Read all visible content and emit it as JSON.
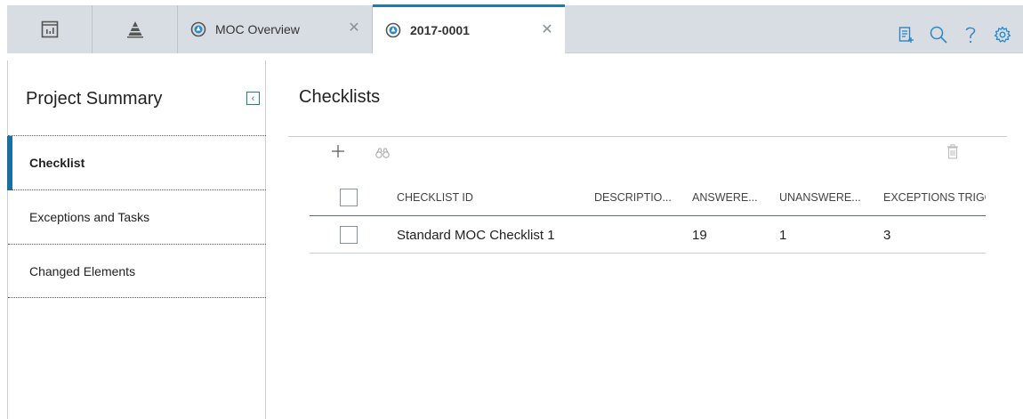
{
  "colors": {
    "accent": "#1b7bb0",
    "link": "#2a7dc4",
    "tab_bg": "#d7dde3"
  },
  "tabs": {
    "icon_tabs": [
      "dashboard-icon",
      "pyramid-icon"
    ],
    "items": [
      {
        "label": "MOC Overview",
        "icon": "moc-cycle-icon",
        "active": false
      },
      {
        "label": "2017-0001",
        "icon": "moc-cycle-icon",
        "active": true
      }
    ]
  },
  "toolbar_icons": [
    "clipboard-add-icon",
    "search-icon",
    "help-icon",
    "settings-icon"
  ],
  "sidebar": {
    "title": "Project Summary",
    "items": [
      {
        "label": "Checklist",
        "active": true
      },
      {
        "label": "Exceptions and Tasks",
        "active": false
      },
      {
        "label": "Changed Elements",
        "active": false
      }
    ]
  },
  "main": {
    "title": "Checklists",
    "actions": [
      "add-icon",
      "binoculars-icon",
      "trash-icon"
    ],
    "columns": [
      "CHECKLIST ID",
      "DESCRIPTIO...",
      "ANSWERE...",
      "UNANSWERE...",
      "EXCEPTIONS TRIGG"
    ],
    "rows": [
      {
        "id": "Standard MOC Checklist 1",
        "description": "",
        "answered": "19",
        "unanswered": "1",
        "exceptions": "3"
      }
    ]
  }
}
